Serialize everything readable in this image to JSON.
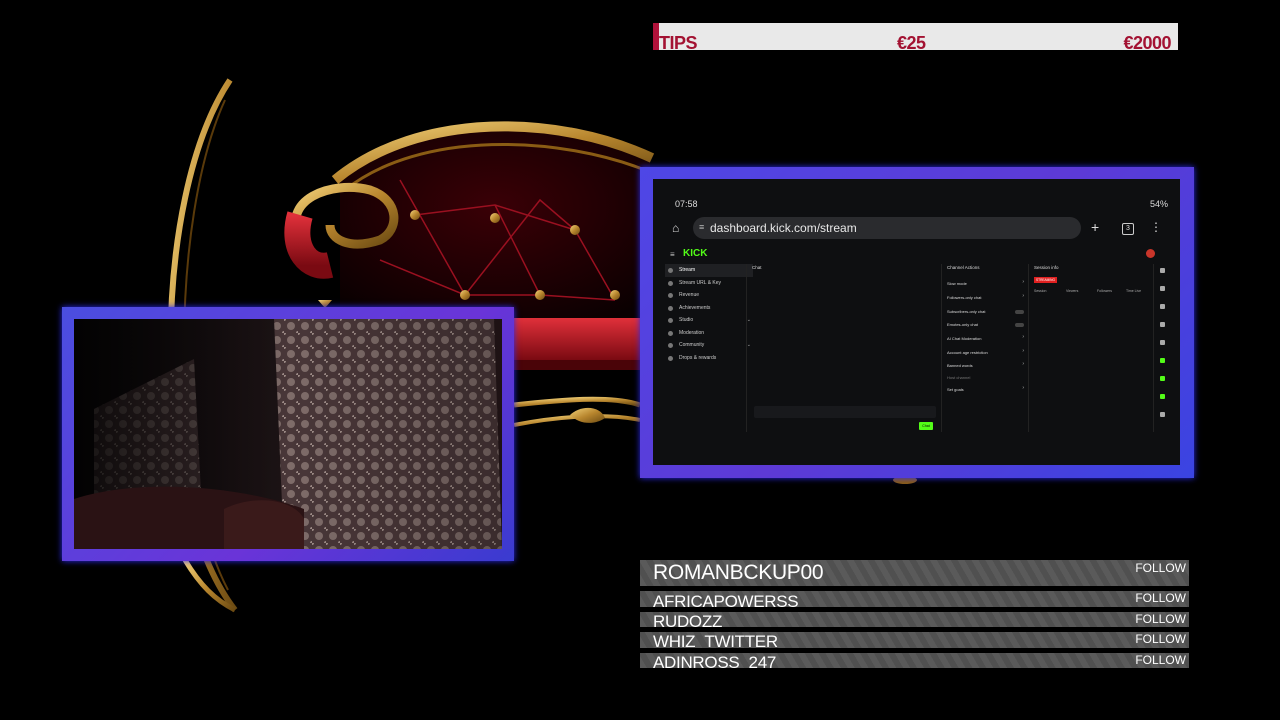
{
  "tips_bar": {
    "label": "TIPS",
    "amount": "€25",
    "goal": "€2000",
    "accent_color": "#b0123a"
  },
  "webcam": {
    "frame_color": "#5a44e0"
  },
  "phone_screen": {
    "status": {
      "time": "07:58",
      "battery": "54%"
    },
    "browser": {
      "url": "dashboard.kick.com/stream",
      "tab_count": "3"
    },
    "kick": {
      "logo": "KICK",
      "accent_color": "#53fc18",
      "nav_items": [
        {
          "label": "Stream",
          "active": true
        },
        {
          "label": "Stream URL & Key",
          "active": false
        },
        {
          "label": "Revenue",
          "active": false
        },
        {
          "label": "Achievements",
          "active": false
        },
        {
          "label": "Studio",
          "active": false
        },
        {
          "label": "Moderation",
          "active": false
        },
        {
          "label": "Community",
          "active": false
        },
        {
          "label": "Drops & rewards",
          "active": false
        }
      ],
      "chat_panel_title": "Chat",
      "chat_button": "Chat",
      "actions_panel_title": "Channel Actions",
      "actions": [
        {
          "label": "Slow mode",
          "control": "arrow"
        },
        {
          "label": "Followers-only chat",
          "control": "arrow"
        },
        {
          "label": "Subscribers-only chat",
          "control": "toggle"
        },
        {
          "label": "Emotes-only chat",
          "control": "toggle"
        },
        {
          "label": "AI Chat Moderation",
          "control": "arrow"
        },
        {
          "label": "Account age restriction",
          "control": "arrow"
        },
        {
          "label": "Banned words",
          "control": "arrow"
        },
        {
          "label": "Host channel",
          "control": "none"
        },
        {
          "label": "Set goals",
          "control": "arrow"
        }
      ],
      "session_panel_title": "Session info",
      "live_badge": "STREAMING",
      "session_labels": [
        "Session",
        "Viewers",
        "Followers",
        "Time Live"
      ]
    }
  },
  "followers": [
    {
      "name": "ROMANBCKUP00",
      "button": "FOLLOW"
    },
    {
      "name": "AFRICAPOWERSS",
      "button": "FOLLOW"
    },
    {
      "name": "RUDOZZ",
      "button": "FOLLOW"
    },
    {
      "name": "WHIZ_TWITTER",
      "button": "FOLLOW"
    },
    {
      "name": "ADINROSS_247",
      "button": "FOLLOW"
    }
  ]
}
